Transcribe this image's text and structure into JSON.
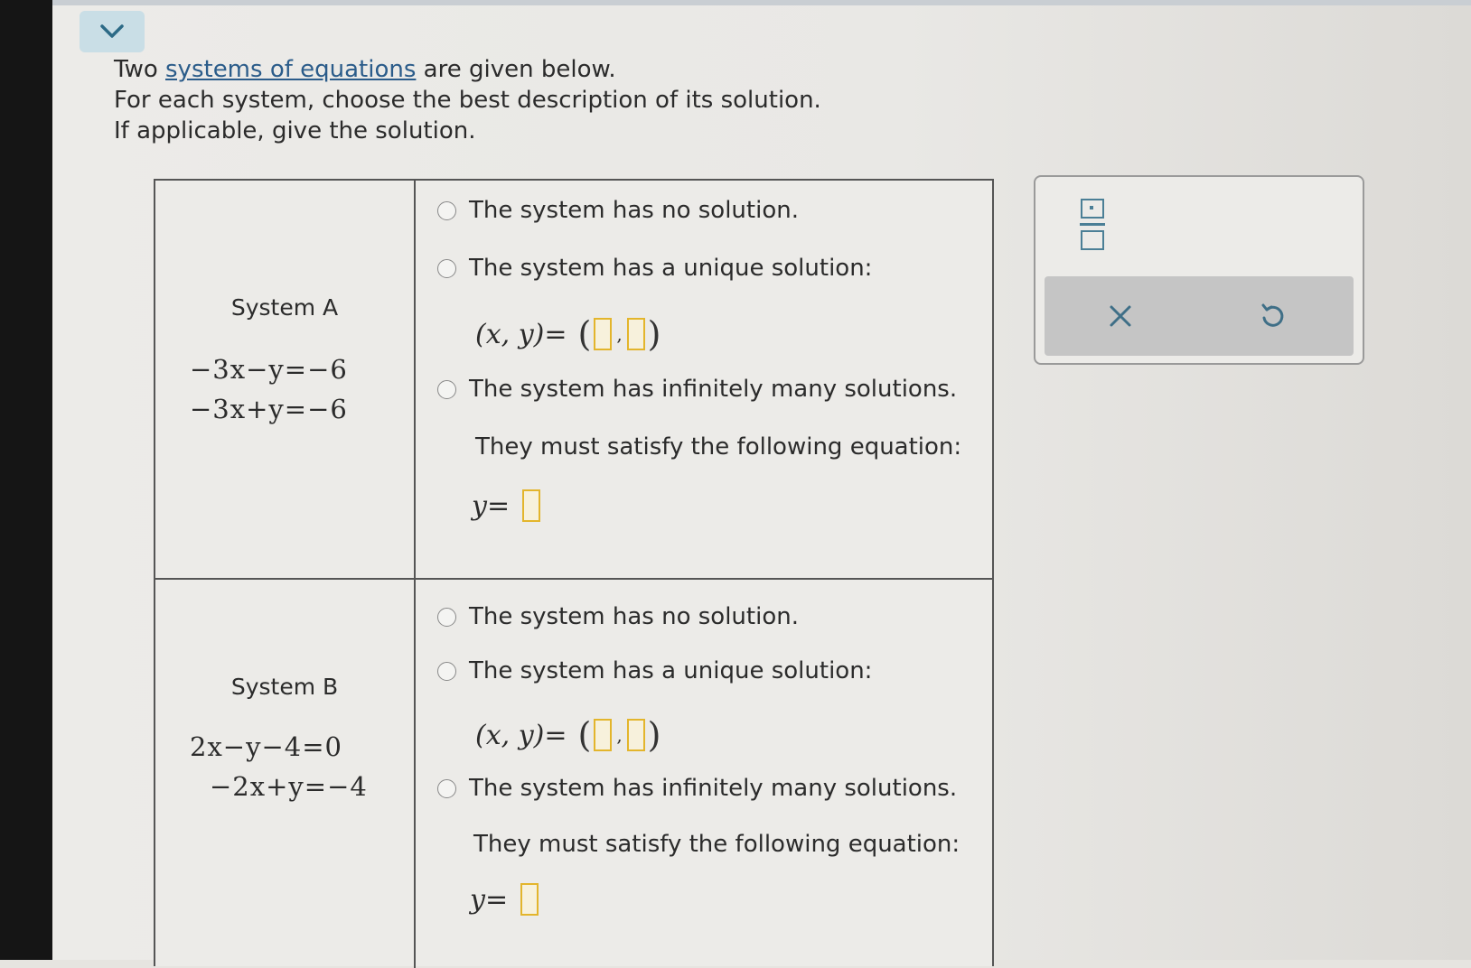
{
  "intro": {
    "line1_before": "Two ",
    "line1_link": "systems of equations",
    "line1_after": " are given below.",
    "line2": "For each system, choose the best description of its solution.",
    "line3": "If applicable, give the solution."
  },
  "systems": [
    {
      "title": "System A",
      "eq1": "−3x−y=−6",
      "eq2": "−3x+y=−6",
      "options": {
        "no_solution": "The system has no solution.",
        "unique": "The system has a unique solution:",
        "unique_prefix": "(x, y)=",
        "infinite": "The system has infinitely many solutions.",
        "satisfy": "They must satisfy the following equation:",
        "y_prefix": "y="
      }
    },
    {
      "title": "System B",
      "eq1": "2x−y−4=0",
      "eq2": "−2x+y=−4",
      "options": {
        "no_solution": "The system has no solution.",
        "unique": "The system has a unique solution:",
        "unique_prefix": "(x, y)=",
        "infinite": "The system has infinitely many solutions.",
        "satisfy": "They must satisfy the following equation:",
        "y_prefix": "y="
      }
    }
  ],
  "tools": {
    "fraction_icon": "fraction-icon",
    "clear_icon": "x-icon",
    "undo_icon": "undo-icon"
  },
  "colors": {
    "input_box": "#e3b52c",
    "link": "#2b5c8a",
    "tool_icon": "#4b7f96"
  }
}
